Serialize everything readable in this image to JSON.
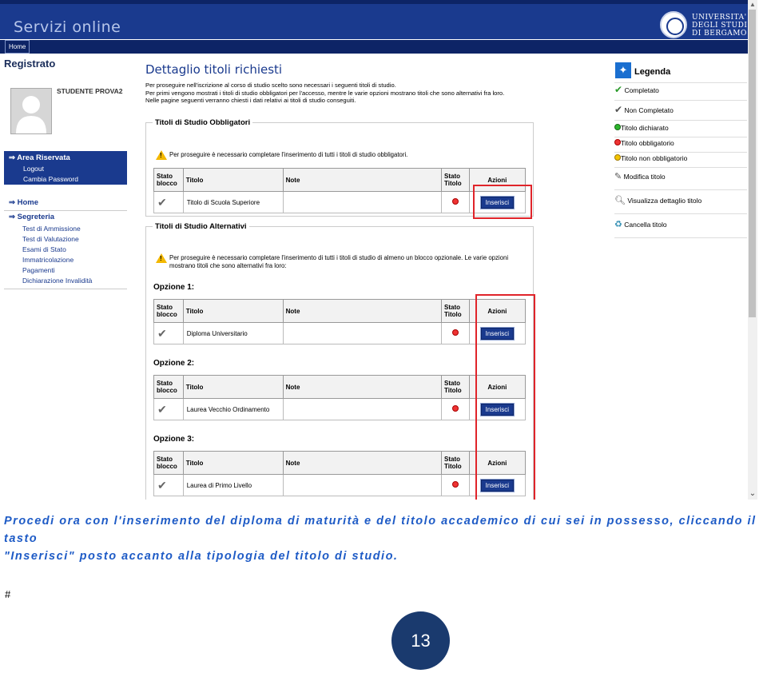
{
  "header": {
    "site_title": "Servizi online",
    "university": [
      "UNIVERSITA'",
      "DEGLI STUDI",
      "DI BERGAMO"
    ],
    "nav_home": "Home"
  },
  "sidebar": {
    "title": "Registrato",
    "student": "STUDENTE PROVA2",
    "area": {
      "label": "Area Riservata",
      "items": [
        "Logout",
        "Cambia Password"
      ]
    },
    "home": "Home",
    "segreteria": {
      "label": "Segreteria",
      "items": [
        "Test di Ammissione",
        "Test di Valutazione",
        "Esami di Stato",
        "Immatricolazione",
        "Pagamenti",
        "Dichiarazione Invalidità"
      ]
    }
  },
  "main": {
    "title": "Dettaglio titoli richiesti",
    "intro": [
      "Per proseguire nell'iscrizione al corso di studio scelto sono necessari i seguenti titoli di studio.",
      "Per primi vengono mostrati i titoli di studio obbligatori per l'accesso, mentre le varie opzioni mostrano titoli che sono alternativi fra loro.",
      "Nelle pagine seguenti verranno chiesti i dati relativi ai titoli di studio conseguiti."
    ],
    "columns": {
      "stato_blocco": "Stato blocco",
      "titolo": "Titolo",
      "note": "Note",
      "stato_titolo": "Stato Titolo",
      "azioni": "Azioni"
    },
    "button_label": "Inserisci",
    "obbligatori": {
      "legend": "Titoli di Studio Obbligatori",
      "warning": "Per proseguire è necessario completare l'inserimento di tutti i titoli di studio obbligatori.",
      "row": {
        "titolo": "Titolo di Scuola Superiore",
        "note": ""
      }
    },
    "alternativi": {
      "legend": "Titoli di Studio Alternativi",
      "warning": "Per proseguire è necessario completare l'inserimento di tutti i titoli di studio di almeno un blocco opzionale. Le varie opzioni mostrano titoli che sono alternativi fra loro:",
      "options": [
        {
          "label": "Opzione 1:",
          "titolo": "Diploma Universitario"
        },
        {
          "label": "Opzione 2:",
          "titolo": "Laurea Vecchio Ordinamento"
        },
        {
          "label": "Opzione 3:",
          "titolo": "Laurea di Primo Livello"
        }
      ]
    }
  },
  "legend_panel": {
    "title": "Legenda",
    "items": [
      "Completato",
      "Non Completato",
      "Titolo dichiarato",
      "Titolo obbligatorio",
      "Titolo non obbligatorio",
      "Modifica titolo",
      "Visualizza dettaglio titolo",
      "Cancella titolo"
    ]
  },
  "caption": {
    "line1": "Procedi ora con l'inserimento del diploma di maturità e del titolo accademico di cui sei in possesso, cliccando il tasto",
    "line2": "\"Inserisci\" posto accanto alla tipologia del titolo di studio."
  },
  "hash": "#",
  "page_number": "13",
  "colors": {
    "brand": "#1a3a8e",
    "highlight": "#e0242a",
    "caption": "#1e5bc6"
  }
}
